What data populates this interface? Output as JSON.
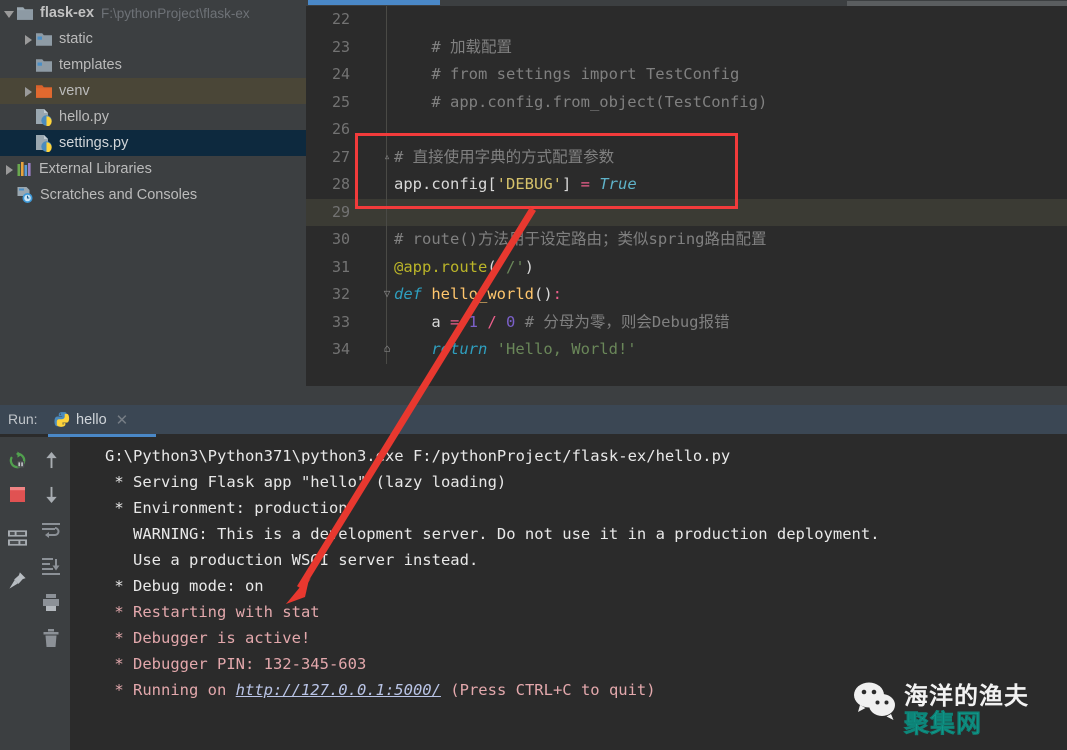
{
  "sidebar": {
    "items": [
      {
        "label": "flask-ex",
        "path": "F:\\pythonProject\\flask-ex",
        "icon": "folder-icon",
        "arrow": "down",
        "indent": 0,
        "state": "normal",
        "bold": true,
        "color": "#c2c2c2"
      },
      {
        "label": "static",
        "path": "",
        "icon": "folder-src-icon",
        "arrow": "right",
        "indent": 1,
        "state": "normal",
        "bold": false,
        "color": "#bbbbbb"
      },
      {
        "label": "templates",
        "path": "",
        "icon": "folder-src-icon",
        "arrow": "none",
        "indent": 1,
        "state": "normal",
        "bold": false,
        "color": "#bbbbbb"
      },
      {
        "label": "venv",
        "path": "",
        "icon": "folder-orange-icon",
        "arrow": "right",
        "indent": 1,
        "state": "hover",
        "bold": false,
        "color": "#bbbbbb"
      },
      {
        "label": "hello.py",
        "path": "",
        "icon": "python-file-icon",
        "arrow": "none",
        "indent": 1,
        "state": "normal",
        "bold": false,
        "color": "#bbbbbb"
      },
      {
        "label": "settings.py",
        "path": "",
        "icon": "python-file-icon",
        "arrow": "none",
        "indent": 1,
        "state": "selected",
        "bold": false,
        "color": "#d2d6d9"
      },
      {
        "label": "External Libraries",
        "path": "",
        "icon": "libraries-icon",
        "arrow": "right",
        "indent": 0,
        "state": "normal",
        "bold": false,
        "color": "#bbbbbb"
      },
      {
        "label": "Scratches and Consoles",
        "path": "",
        "icon": "scratches-icon",
        "arrow": "none",
        "indent": 0,
        "state": "normal",
        "bold": false,
        "color": "#bbbbbb"
      }
    ]
  },
  "editor": {
    "lines": [
      {
        "num": "22",
        "fold": "",
        "current": false,
        "tokens": []
      },
      {
        "num": "23",
        "fold": "",
        "current": false,
        "tokens": [
          {
            "t": "    # 加载配置",
            "c": "cm"
          }
        ]
      },
      {
        "num": "24",
        "fold": "",
        "current": false,
        "tokens": [
          {
            "t": "    # from settings import TestConfig",
            "c": "cm"
          }
        ]
      },
      {
        "num": "25",
        "fold": "",
        "current": false,
        "tokens": [
          {
            "t": "    # app.config.from_object(TestConfig)",
            "c": "cm"
          }
        ]
      },
      {
        "num": "26",
        "fold": "",
        "current": false,
        "tokens": []
      },
      {
        "num": "27",
        "fold": "▵",
        "current": false,
        "tokens": [
          {
            "t": "# 直接使用字典的方式配置参数",
            "c": "cm"
          }
        ]
      },
      {
        "num": "28",
        "fold": "",
        "current": false,
        "tokens": [
          {
            "t": "app.config[",
            "c": "pln"
          },
          {
            "t": "'DEBUG'",
            "c": "strY"
          },
          {
            "t": "]",
            "c": "pln"
          },
          {
            "t": " = ",
            "c": "op"
          },
          {
            "t": "True",
            "c": "tru"
          }
        ]
      },
      {
        "num": "29",
        "fold": "",
        "current": true,
        "tokens": []
      },
      {
        "num": "30",
        "fold": "",
        "current": false,
        "tokens": [
          {
            "t": "# route()方法用于设定路由；类似spring路由配置",
            "c": "cm"
          }
        ]
      },
      {
        "num": "31",
        "fold": "",
        "current": false,
        "tokens": [
          {
            "t": "@app.route",
            "c": "deco"
          },
          {
            "t": "(",
            "c": "pln"
          },
          {
            "t": "'/'",
            "c": "str"
          },
          {
            "t": ")",
            "c": "pln"
          }
        ]
      },
      {
        "num": "32",
        "fold": "▽",
        "current": false,
        "tokens": [
          {
            "t": "def ",
            "c": "kwi"
          },
          {
            "t": "hello_world",
            "c": "fn"
          },
          {
            "t": "()",
            "c": "pln"
          },
          {
            "t": ":",
            "c": "op"
          }
        ]
      },
      {
        "num": "33",
        "fold": "",
        "current": false,
        "tokens": [
          {
            "t": "    a",
            "c": "pln"
          },
          {
            "t": " = ",
            "c": "op"
          },
          {
            "t": "1",
            "c": "num"
          },
          {
            "t": " / ",
            "c": "op"
          },
          {
            "t": "0",
            "c": "num"
          },
          {
            "t": " # 分母为零，则会Debug报错",
            "c": "cm"
          }
        ]
      },
      {
        "num": "34",
        "fold": "⌂",
        "current": false,
        "tokens": [
          {
            "t": "    return ",
            "c": "kwi"
          },
          {
            "t": "'Hello, World!'",
            "c": "str"
          }
        ]
      }
    ]
  },
  "run_panel": {
    "run_label": "Run:",
    "tab_name": "hello",
    "tab_close": "✕",
    "toolbar_left": [
      {
        "name": "rerun-icon",
        "color": "#51a04e"
      },
      {
        "name": "stop-icon",
        "color": "#e05252"
      },
      {
        "name": "console-icon",
        "color": "#a8adb2"
      },
      {
        "name": "pin-icon",
        "color": "#a8adb2"
      }
    ],
    "toolbar_right": [
      {
        "name": "up-arrow-icon",
        "color": "#a8adb2"
      },
      {
        "name": "down-arrow-icon",
        "color": "#a8adb2"
      },
      {
        "name": "soft-wrap-icon",
        "color": "#8c9197"
      },
      {
        "name": "scroll-to-end-icon",
        "color": "#8c9197"
      },
      {
        "name": "print-icon",
        "color": "#8c9197"
      },
      {
        "name": "trash-icon",
        "color": "#8c9197"
      }
    ],
    "output": [
      {
        "text": "G:\\Python3\\Python371\\python3.exe F:/pythonProject/flask-ex/hello.py",
        "style": "white",
        "indent": "none"
      },
      {
        "text": " * Serving Flask app \"hello\" (lazy loading)",
        "style": "white",
        "indent": "none"
      },
      {
        "text": " * Environment: production",
        "style": "white",
        "indent": "none"
      },
      {
        "text": "   WARNING: This is a development server. Do not use it in a production deployment.",
        "style": "white",
        "indent": "none"
      },
      {
        "text": "   Use a production WSGI server instead.",
        "style": "white",
        "indent": "none"
      },
      {
        "text": " * Debug mode: on",
        "style": "white",
        "indent": "none"
      },
      {
        "text": " * Restarting with stat",
        "style": "pink",
        "indent": "none"
      },
      {
        "text": " * Debugger is active!",
        "style": "pink",
        "indent": "none"
      },
      {
        "text": " * Debugger PIN: 132-345-603",
        "style": "pink",
        "indent": "none"
      },
      {
        "text": " * Running on ",
        "style": "pink",
        "indent": "none",
        "link": "http://127.0.0.1:5000/",
        "suffix": " (Press CTRL+C to quit)"
      }
    ]
  },
  "annotations": {
    "box_color": "#f23b3b",
    "arrow_color": "#e8382f"
  },
  "watermark": {
    "line1": "海洋的渔夫",
    "line2": "聚集网",
    "icon": "wechat-icon"
  }
}
